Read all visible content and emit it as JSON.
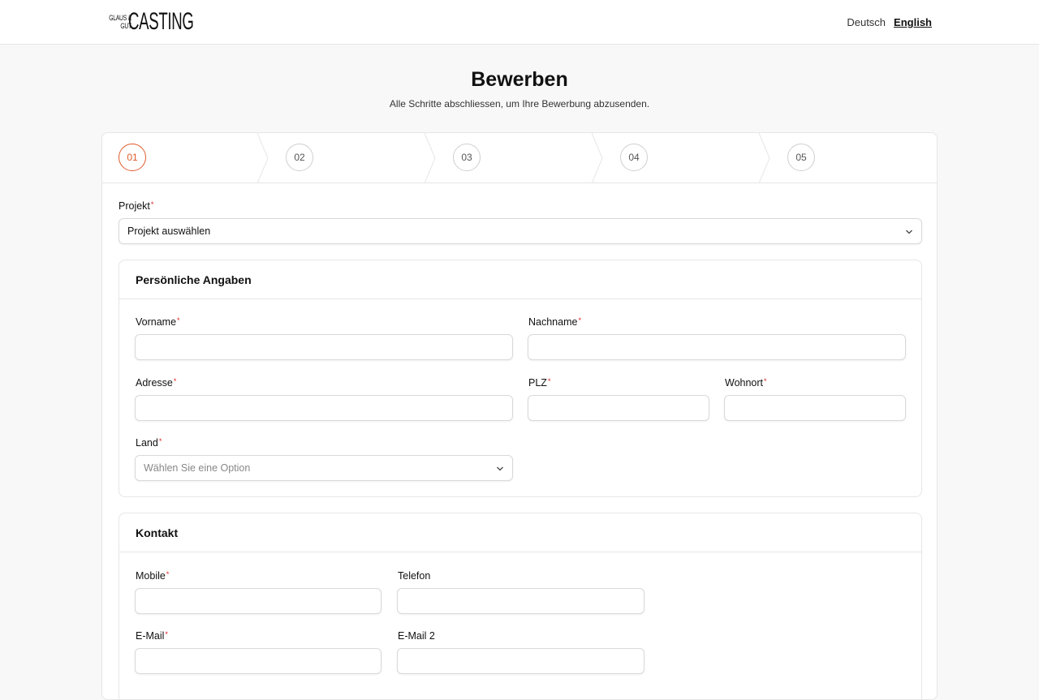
{
  "header": {
    "logo_small_line1": "GLAUS &",
    "logo_small_line2": "GUT",
    "logo_big": "CASTING",
    "lang_de": "Deutsch",
    "lang_en": "English"
  },
  "page": {
    "title": "Bewerben",
    "subtitle": "Alle Schritte abschliessen, um Ihre Bewerbung abzusenden."
  },
  "steps": [
    "01",
    "02",
    "03",
    "04",
    "05"
  ],
  "project": {
    "label": "Projekt",
    "value": "Projekt auswählen"
  },
  "personal": {
    "title": "Persönliche Angaben",
    "firstname": "Vorname",
    "lastname": "Nachname",
    "address": "Adresse",
    "zip": "PLZ",
    "city": "Wohnort",
    "country": "Land",
    "country_placeholder": "Wählen Sie eine Option"
  },
  "contact": {
    "title": "Kontakt",
    "mobile": "Mobile",
    "phone": "Telefon",
    "email": "E-Mail",
    "email2": "E-Mail 2"
  },
  "required_mark": "*",
  "colors": {
    "accent": "#e05a2b",
    "required": "#e02020"
  }
}
